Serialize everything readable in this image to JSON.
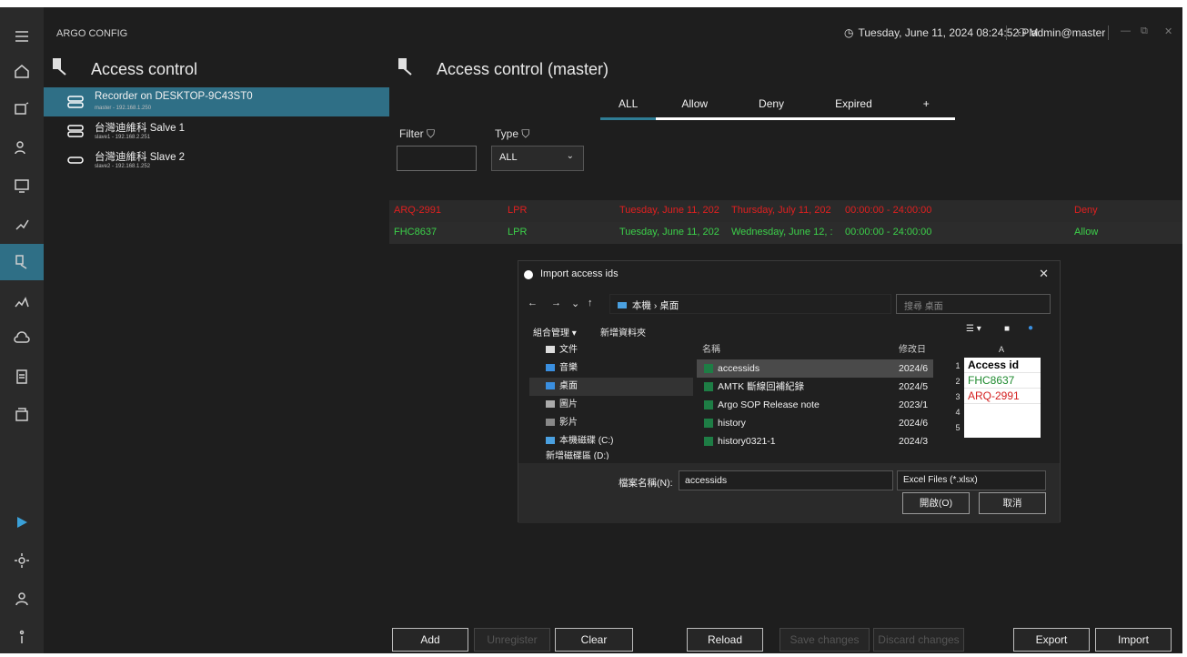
{
  "window": {
    "app_title": "ARGO CONFIG",
    "datetime": "Tuesday, June 11, 2024 08:24:52 PM",
    "user": "admin@master"
  },
  "left_panel": {
    "title": "Access control",
    "devices": [
      {
        "name": "Recorder on DESKTOP-9C43ST0",
        "sub": "master - 192.168.1.250"
      },
      {
        "name": "台灣迪維科 Salve 1",
        "sub": "slave1 - 192.168.2.251"
      },
      {
        "name": "台灣迪維科 Slave 2",
        "sub": "slave2 - 192.168.1.252"
      }
    ]
  },
  "right_panel": {
    "title": "Access control (master)",
    "tabs": [
      "ALL",
      "Allow",
      "Deny",
      "Expired",
      "+"
    ],
    "filter_label": "Filter",
    "type_label": "Type",
    "type_value": "ALL",
    "rows": [
      {
        "id": "ARQ-2991",
        "type": "LPR",
        "start": "Tuesday, June 11, 202",
        "end": "Thursday, July 11, 202",
        "time": "00:00:00 - 24:00:00",
        "status": "Deny"
      },
      {
        "id": "FHC8637",
        "type": "LPR",
        "start": "Tuesday, June 11, 202",
        "end": "Wednesday, June 12, :",
        "time": "00:00:00 - 24:00:00",
        "status": "Allow"
      }
    ],
    "buttons": {
      "add": "Add",
      "unregister": "Unregister",
      "clear": "Clear",
      "reload": "Reload",
      "save": "Save changes",
      "discard": "Discard changes",
      "export": "Export",
      "import": "Import"
    }
  },
  "dialog": {
    "title": "Import access ids",
    "path": "本機 › 桌面",
    "search_placeholder": "搜尋 桌面",
    "organize": "組合管理 ▾",
    "new_folder": "新增資料夾",
    "tree": [
      "文件",
      "音樂",
      "桌面",
      "圖片",
      "影片",
      "本機磁碟 (C:)",
      "新增磁碟區 (D:)"
    ],
    "col_name": "名稱",
    "col_date": "修改日期",
    "files": [
      {
        "name": "accessids",
        "date": "2024/6"
      },
      {
        "name": "AMTK 斷線回補紀錄",
        "date": "2024/5"
      },
      {
        "name": "Argo SOP Release note",
        "date": "2023/1"
      },
      {
        "name": "history",
        "date": "2024/6"
      },
      {
        "name": "history0321-1",
        "date": "2024/3"
      }
    ],
    "preview": {
      "col": "A",
      "cells": [
        "Access id",
        "FHC8637",
        "ARQ-2991"
      ],
      "rows": [
        "1",
        "2",
        "3",
        "4",
        "5"
      ]
    },
    "filename_label": "檔案名稱(N):",
    "filename_value": "accessids",
    "filetype": "Excel Files (*.xlsx)",
    "open": "開啟(O)",
    "cancel": "取消"
  }
}
